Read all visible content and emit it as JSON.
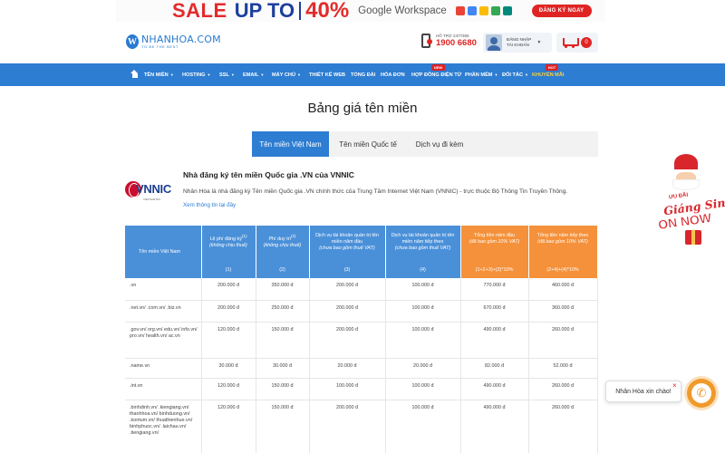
{
  "promo_banner": {
    "sale": "SALE",
    "upto": "UP TO",
    "discount": "40%",
    "product": "Google Workspace",
    "cta": "ĐĂNG KÝ NGAY"
  },
  "header": {
    "logo_name": "NHANHOA.COM",
    "logo_tagline": "TO BE THE BEST",
    "hotline_label": "HỖ TRỢ 24/7/365",
    "hotline_number": "1900 6680",
    "account_line1": "ĐĂNG NHẬP",
    "account_line2": "TÀI KHOẢN",
    "cart_count": "0"
  },
  "nav": {
    "items": [
      {
        "label": "TÊN MIỀN",
        "caret": "▼"
      },
      {
        "label": "HOSTING",
        "caret": "▼"
      },
      {
        "label": "SSL",
        "caret": "▼"
      },
      {
        "label": "EMAIL",
        "caret": "▼"
      },
      {
        "label": "MÁY CHỦ",
        "caret": "▼"
      },
      {
        "label": "THIẾT KẾ WEB",
        "caret": ""
      },
      {
        "label": "TỔNG ĐÀI",
        "caret": ""
      },
      {
        "label": "HÓA ĐƠN",
        "caret": ""
      },
      {
        "label": "HỢP ĐỒNG ĐIỆN TỬ",
        "caret": "",
        "badge": "NEW"
      },
      {
        "label": "PHẦN MỀM",
        "caret": "▼"
      },
      {
        "label": "ĐỐI TÁC",
        "caret": "▼"
      },
      {
        "label": "KHUYẾN MÃI",
        "caret": "",
        "badge": "HOT"
      }
    ]
  },
  "page_title": "Bảng giá tên miền",
  "tabs": [
    "Tên miền Việt Nam",
    "Tên miền Quốc tế",
    "Dịch vụ đi kèm"
  ],
  "registrar": {
    "logo_text": "VNNIC",
    "logo_sub": "VIETNAM NIC",
    "title": "Nhà đăng ký tên miền Quốc gia .VN của VNNIC",
    "description": "Nhân Hòa là nhà đăng ký Tên miền Quốc gia .VN chính thức của Trung Tâm Internet Việt Nam (VNNIC) - trực thuộc Bộ Thông Tin Truyền Thông.",
    "link": "Xem thông tin tại đây"
  },
  "table": {
    "headers": [
      {
        "text": "Tên miền Việt Nam",
        "num": ""
      },
      {
        "text": "Lệ phí đăng ký",
        "sup": "(1)",
        "note": "(không chịu thuế)",
        "num": "(1)"
      },
      {
        "text": "Phí duy trì",
        "sup": "(2)",
        "note": "(không chịu thuế)",
        "num": "(2)"
      },
      {
        "text": "Dịch vụ tài khoản quản trị tên miền năm đầu",
        "note": "(chưa bao gồm thuế VAT)",
        "num": "(3)"
      },
      {
        "text": "Dịch vụ tài khoản quản trị tên miền năm tiếp theo",
        "note": "(chưa bao gồm thuế VAT)",
        "num": "(4)"
      },
      {
        "text": "Tổng tiền năm đầu",
        "note": "(đã bao gồm 10% VAT)",
        "num": "(1+2+3)+(3)*10%"
      },
      {
        "text": "Tổng tiền năm tiếp theo",
        "note": "(đã bao gồm 10% VAT)",
        "num": "(2+4)+(4)*10%"
      }
    ],
    "rows": [
      {
        "name": ".vn",
        "fee": "200.000 đ",
        "maintain": "350.000 đ",
        "first": "200.000 đ",
        "next": "100.000 đ",
        "total_first": "770.000 đ",
        "total_next": "460.000 đ"
      },
      {
        "name": ".net.vn/ .com.vn/ .biz.vn",
        "fee": "200.000 đ",
        "maintain": "250.000 đ",
        "first": "200.000 đ",
        "next": "100.000 đ",
        "total_first": "670.000 đ",
        "total_next": "360.000 đ"
      },
      {
        "name": ".gov.vn/ org.vn/ edu.vn/ info.vn/ pro.vn/ health.vn/ ac.vn",
        "fee": "120.000 đ",
        "maintain": "150.000 đ",
        "first": "200.000 đ",
        "next": "100.000 đ",
        "total_first": "490.000 đ",
        "total_next": "260.000 đ"
      },
      {
        "name": ".name.vn",
        "fee": "30.000 đ",
        "maintain": "30.000 đ",
        "first": "20.000 đ",
        "next": "20.000 đ",
        "total_first": "82.000 đ",
        "total_next": "52.000 đ"
      },
      {
        "name": ".int.vn",
        "fee": "120.000 đ",
        "maintain": "150.000 đ",
        "first": "100.000 đ",
        "next": "100.000 đ",
        "total_first": "490.000 đ",
        "total_next": "260.000 đ"
      },
      {
        "name": ".binhdinh.vn/ .kiengiang.vn/ thanhhoa.vn/ binhduong.vn/ .kontum.vn/ thuathienhue.vn/ binhphuoc.vn/ .laichau.vn/ .tiengiang.vn/",
        "fee": "120.000 đ",
        "maintain": "150.000 đ",
        "first": "200.000 đ",
        "next": "100.000 đ",
        "total_first": "490.000 đ",
        "total_next": "260.000 đ"
      }
    ]
  },
  "side_promo": {
    "small": "ƯU ĐÃI",
    "script": "Giáng Sinh",
    "big": "ON NOW"
  },
  "chat": {
    "greeting": "Nhân Hòa xin chào!",
    "close": "×",
    "phone_glyph": "✆"
  },
  "colors": {
    "primary": "#2d7dd2",
    "accent_red": "#e02424",
    "table_orange": "#f4913a",
    "table_blue": "#4a90d9"
  }
}
